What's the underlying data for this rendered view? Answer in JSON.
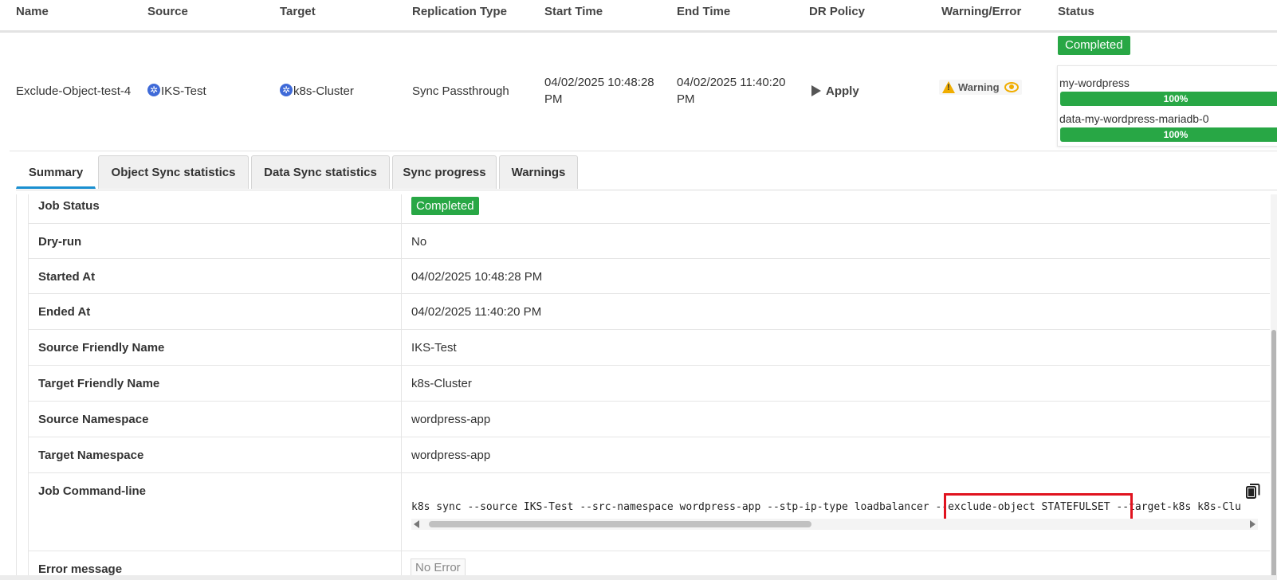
{
  "columns": [
    "Name",
    "Source",
    "Target",
    "Replication Type",
    "Start Time",
    "End Time",
    "DR Policy",
    "Warning/Error",
    "Status"
  ],
  "job": {
    "name": "Exclude-Object-test-4",
    "source": "IKS-Test",
    "target": "k8s-Cluster",
    "replication_type": "Sync Passthrough",
    "start_time_line1": "04/02/2025 10:48:28",
    "start_time_line2": "PM",
    "end_time_line1": "04/02/2025 11:40:20",
    "end_time_line2": "PM",
    "dr_policy": "Apply",
    "warning_label": "Warning",
    "status": "Completed",
    "progress": [
      {
        "label": "my-wordpress",
        "percent": 100,
        "percent_text": "100%"
      },
      {
        "label": "data-my-wordpress-mariadb-0",
        "percent": 100,
        "percent_text": "100%"
      }
    ]
  },
  "tabs": [
    "Summary",
    "Object Sync statistics",
    "Data Sync statistics",
    "Sync progress",
    "Warnings"
  ],
  "summary": {
    "job_status_label": "Job Status",
    "job_status_value": "Completed",
    "dry_run_label": "Dry-run",
    "dry_run_value": "No",
    "started_label": "Started At",
    "started_value": "04/02/2025 10:48:28 PM",
    "ended_label": "Ended At",
    "ended_value": "04/02/2025 11:40:20 PM",
    "src_friendly_label": "Source Friendly Name",
    "src_friendly_value": "IKS-Test",
    "tgt_friendly_label": "Target Friendly Name",
    "tgt_friendly_value": "k8s-Cluster",
    "src_ns_label": "Source Namespace",
    "src_ns_value": "wordpress-app",
    "tgt_ns_label": "Target Namespace",
    "tgt_ns_value": "wordpress-app",
    "cmd_label": "Job Command-line",
    "cmd_value": "k8s sync --source IKS-Test --src-namespace wordpress-app --stp-ip-type loadbalancer --exclude-object STATEFULSET --target-k8s k8s-Clu",
    "error_label": "Error message",
    "error_value": "No Error"
  },
  "colors": {
    "accent": "#1a8fd0",
    "success": "#28a745",
    "warning": "#f0ad00",
    "highlight": "#e0131f"
  },
  "icons": {
    "kube": "kubernetes-icon",
    "play": "play-icon",
    "warn": "warning-icon",
    "eye": "eye-icon",
    "copy": "copy-icon"
  }
}
